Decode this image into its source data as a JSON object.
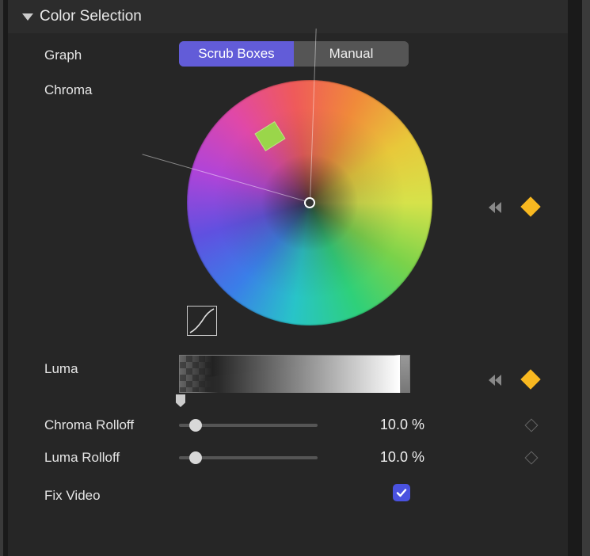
{
  "section": {
    "title": "Color Selection"
  },
  "graph": {
    "label": "Graph",
    "tabs": {
      "scrub": "Scrub Boxes",
      "manual": "Manual"
    },
    "activeTab": "scrub"
  },
  "chroma": {
    "label": "Chroma"
  },
  "luma": {
    "label": "Luma"
  },
  "chromaRolloff": {
    "label": "Chroma Rolloff",
    "value": "10.0",
    "unit": "%",
    "sliderPercent": 10
  },
  "lumaRolloff": {
    "label": "Luma Rolloff",
    "value": "10.0",
    "unit": "%",
    "sliderPercent": 10
  },
  "fixVideo": {
    "label": "Fix Video",
    "checked": true
  }
}
